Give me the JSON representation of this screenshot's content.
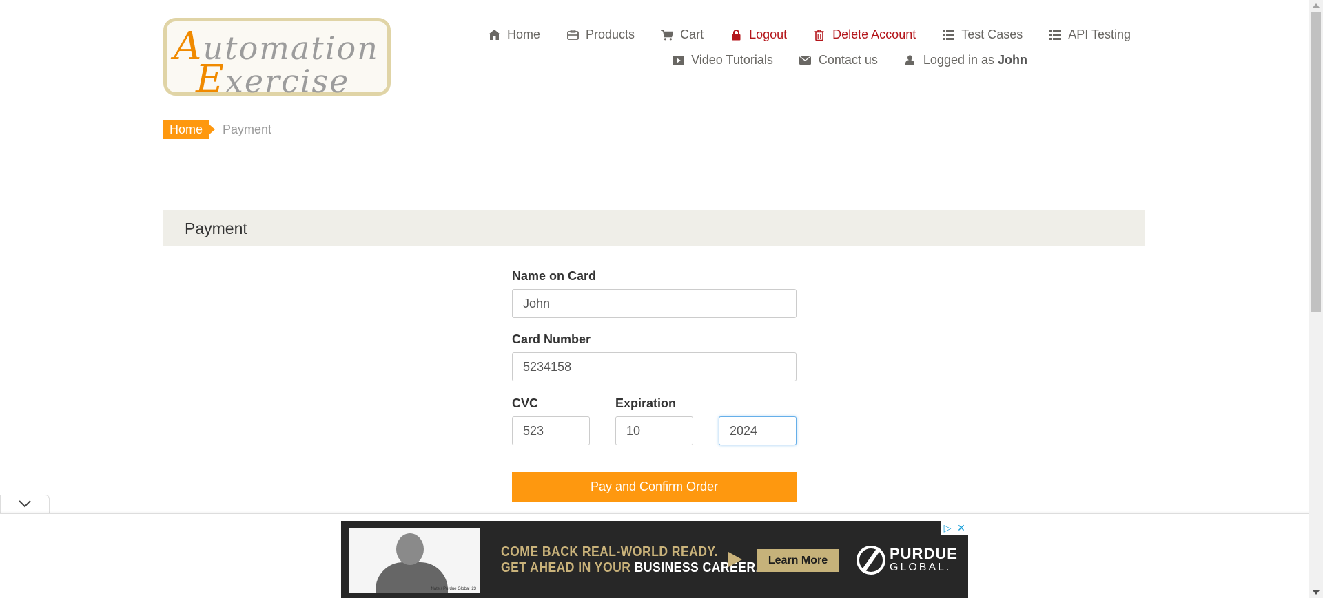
{
  "logo": {
    "line1_cap": "A",
    "line1_rest": "utomation",
    "line2_cap": "E",
    "line2_rest": "xercise"
  },
  "nav": {
    "row1": [
      {
        "label": "Home",
        "icon": "home-icon"
      },
      {
        "label": "Products",
        "icon": "products-icon"
      },
      {
        "label": "Cart",
        "icon": "cart-icon"
      },
      {
        "label": "Logout",
        "icon": "lock-icon"
      },
      {
        "label": "Delete Account",
        "icon": "trash-icon"
      },
      {
        "label": "Test Cases",
        "icon": "list-icon"
      },
      {
        "label": "API Testing",
        "icon": "list-icon"
      }
    ],
    "row2": [
      {
        "label": "Video Tutorials",
        "icon": "youtube-icon"
      },
      {
        "label": "Contact us",
        "icon": "envelope-icon"
      },
      {
        "label": "Logged in as",
        "user": "John",
        "icon": "user-icon"
      }
    ]
  },
  "breadcrumb": {
    "home": "Home",
    "current": "Payment"
  },
  "payment": {
    "heading": "Payment",
    "name_label": "Name on Card",
    "name_value": "John",
    "card_label": "Card Number",
    "card_value": "5234158",
    "cvc_label": "CVC",
    "cvc_value": "523",
    "expiration_label": "Expiration",
    "exp_month": "10",
    "exp_year": "2024",
    "submit_label": "Pay and Confirm Order"
  },
  "ad": {
    "headline_line1": "COME BACK REAL-WORLD READY.",
    "headline_line2_a": "GET AHEAD IN YOUR ",
    "headline_line2_b": "BUSINESS CAREER.",
    "cta": "Learn More",
    "brand_line1": "PURDUE",
    "brand_line2": "GLOBAL.",
    "photo_credit": "Nate / Purdue Global '23"
  },
  "colors": {
    "accent": "#fe980f",
    "danger": "#b4161b",
    "nav_text": "#696763"
  }
}
